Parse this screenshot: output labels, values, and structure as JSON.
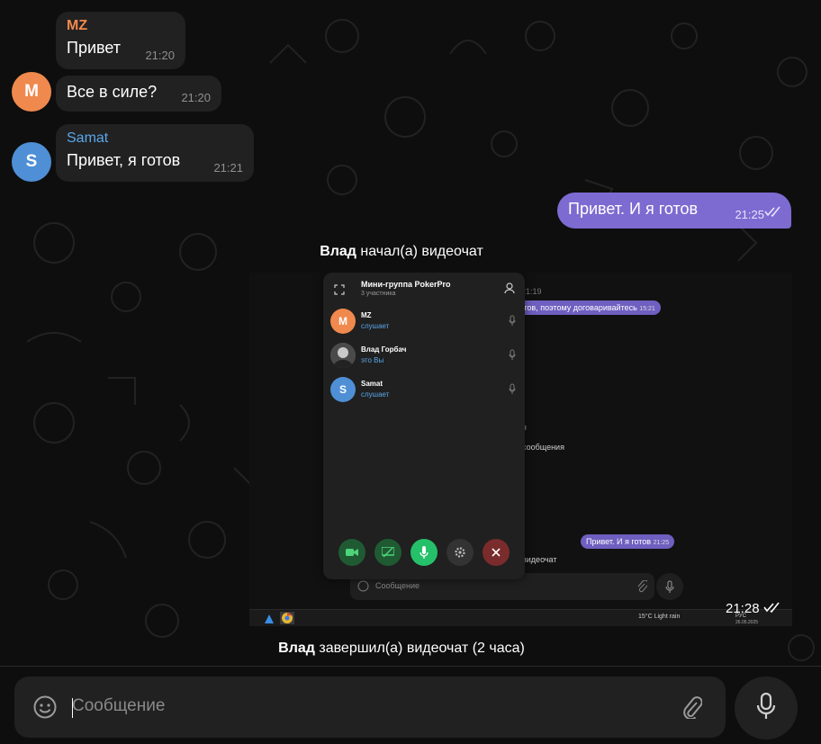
{
  "colors": {
    "accent": "#7d6bd1",
    "incoming_bubble": "#212121",
    "avatar_mz": "#f0894d",
    "avatar_samat": "#4f8fd6",
    "name_mz": "#f0894d",
    "name_samat": "#5aa7ea"
  },
  "messages": [
    {
      "sender": "MZ",
      "text": "Привет",
      "time": "21:20"
    },
    {
      "avatar_letter": "M",
      "text": "Все в силе?",
      "time": "21:20"
    },
    {
      "sender": "Samat",
      "avatar_letter": "S",
      "text": "Привет, я готов",
      "time": "21:21"
    },
    {
      "text": "Привет. И я готов",
      "time": "21:25",
      "status": "read"
    }
  ],
  "service": {
    "started_name": "Влад",
    "started_text": " начал(а) видеочат",
    "ended_name": "Влад",
    "ended_text": " завершил(а) видеочат (2 часа)"
  },
  "video_message": {
    "time": "21:28",
    "status": "read",
    "call_panel": {
      "title": "Мини-группа PokerPro",
      "subtitle": "3 участника",
      "participants": [
        {
          "name": "MZ",
          "status": "слушает",
          "avatar_letter": "M"
        },
        {
          "name": "Влад Горбач",
          "status": "это Вы",
          "avatar_letter": ""
        },
        {
          "name": "Samat",
          "status": "слушает",
          "avatar_letter": "S"
        }
      ]
    },
    "background_chat": {
      "time_top": "21:19",
      "message_top": "е готов, поэтому договаривайтесь",
      "message_top_time": "15:21",
      "line_a": "я",
      "line_b": "сообщения",
      "message_bottom": "Привет. И я готов",
      "message_bottom_time": "21:25",
      "line_c": "видеочат",
      "input_placeholder": "Сообщение"
    },
    "taskbar": {
      "weather": "15°C  Light rain",
      "lang": "РУС",
      "date": "26.05.2025"
    }
  },
  "composer": {
    "placeholder": "Сообщение"
  }
}
